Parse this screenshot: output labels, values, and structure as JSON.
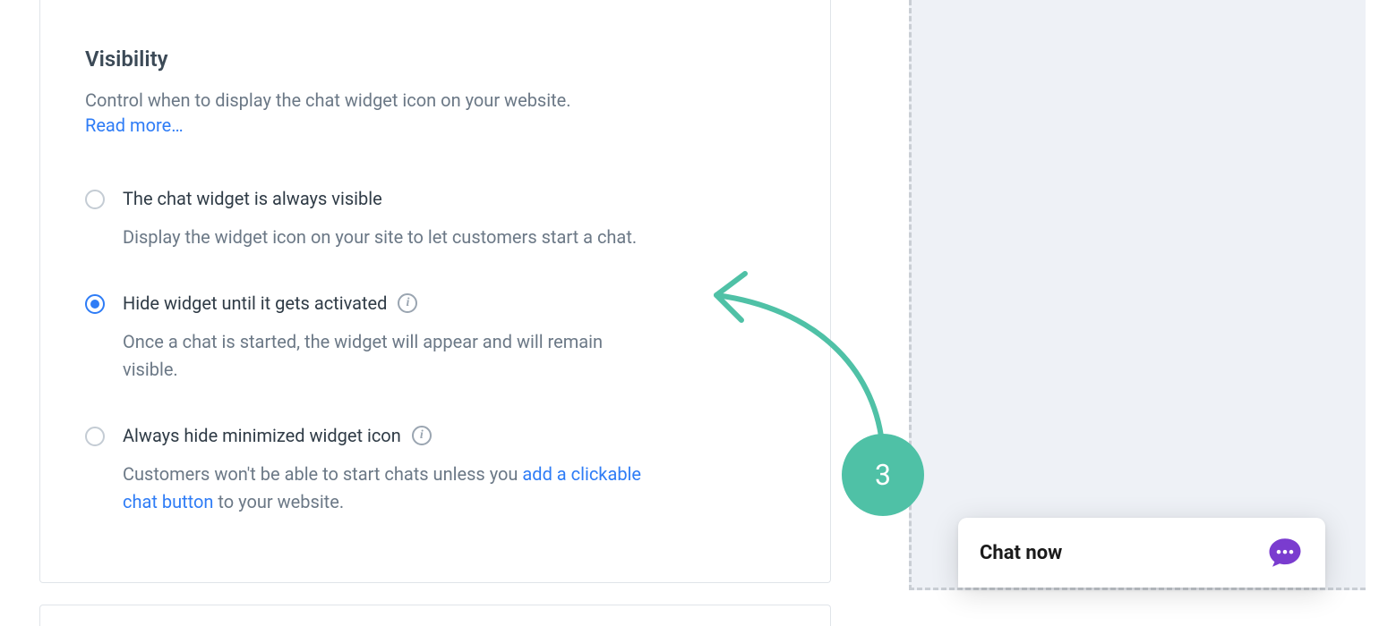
{
  "visibility": {
    "title": "Visibility",
    "description": "Control when to display the chat widget icon on your website.",
    "read_more": "Read more…",
    "options": [
      {
        "label": "The chat widget is always visible",
        "description": "Display the widget icon on your site to let customers start a chat.",
        "selected": false,
        "has_info": false
      },
      {
        "label": "Hide widget until it gets activated",
        "description": "Once a chat is started, the widget will appear and will remain visible.",
        "selected": true,
        "has_info": true
      },
      {
        "label": "Always hide minimized widget icon",
        "description_pre": "Customers won't be able to start chats unless you ",
        "description_link": "add a clickable chat button",
        "description_post": " to your website.",
        "selected": false,
        "has_info": true
      }
    ]
  },
  "preview": {
    "chat_label": "Chat now"
  },
  "annotation": {
    "step": "3"
  }
}
